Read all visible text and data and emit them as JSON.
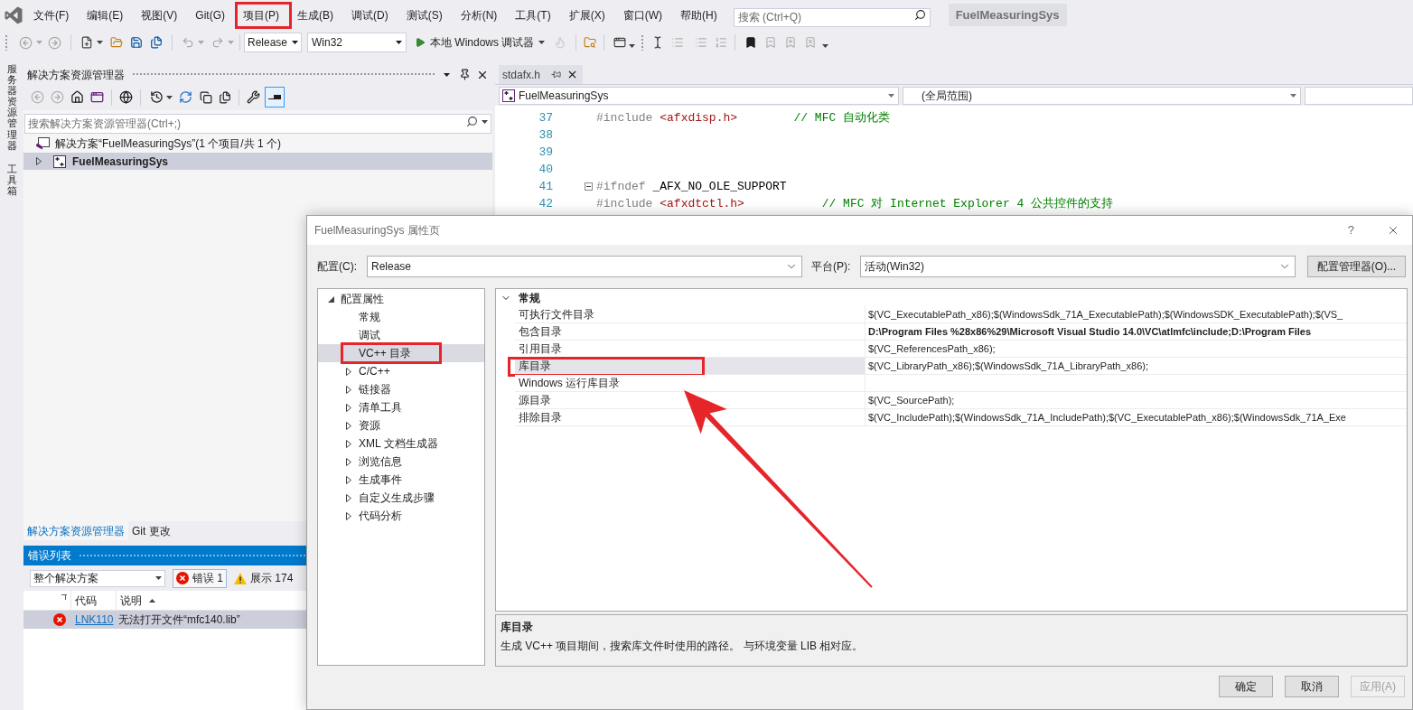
{
  "menu_bar": {
    "items": [
      {
        "label": "文件(F)",
        "marked": false
      },
      {
        "label": "编辑(E)",
        "marked": false
      },
      {
        "label": "视图(V)",
        "marked": false
      },
      {
        "label": "Git(G)",
        "marked": false
      },
      {
        "label": "项目(P)",
        "marked": true
      },
      {
        "label": "生成(B)",
        "marked": false
      },
      {
        "label": "调试(D)",
        "marked": false
      },
      {
        "label": "测试(S)",
        "marked": false
      },
      {
        "label": "分析(N)",
        "marked": false
      },
      {
        "label": "工具(T)",
        "marked": false
      },
      {
        "label": "扩展(X)",
        "marked": false
      },
      {
        "label": "窗口(W)",
        "marked": false
      },
      {
        "label": "帮助(H)",
        "marked": false
      }
    ],
    "search": {
      "placeholder": "搜索 (Ctrl+Q)"
    },
    "solution_badge": "FuelMeasuringSys"
  },
  "toolbar": {
    "configuration": "Release",
    "platform": "Win32",
    "debug_target": "本地 Windows 调试器"
  },
  "side_tabs": [
    {
      "label": "服务器资源管理器"
    },
    {
      "label": "工具箱"
    }
  ],
  "solution_explorer": {
    "title": "解决方案资源管理器",
    "search": {
      "placeholder": "搜索解决方案资源管理器(Ctrl+;)"
    },
    "tree": [
      {
        "kind": "solution",
        "label": "解决方案“FuelMeasuringSys”(1 个项目/共 1 个)",
        "selected": false,
        "children": [
          {
            "kind": "project",
            "label": "FuelMeasuringSys",
            "selected": true,
            "expanded": false
          }
        ]
      }
    ],
    "tabs": [
      {
        "label": "解决方案资源管理器",
        "selected": true
      },
      {
        "label": "Git 更改",
        "selected": false
      }
    ]
  },
  "error_list": {
    "title": "错误列表",
    "scope": "整个解决方案",
    "filters": [
      {
        "kind": "error",
        "label": "错误 1",
        "on": true
      },
      {
        "kind": "warning",
        "label": "展示 174",
        "on": false
      }
    ],
    "columns": [
      {
        "label": "代码",
        "sorted": false
      },
      {
        "label": "说明",
        "sorted": true
      }
    ],
    "rows": [
      {
        "kind": "error",
        "code": "LNK110",
        "description": "无法打开文件“mfc140.lib”",
        "selected": true
      }
    ]
  },
  "editor": {
    "tabs": [
      {
        "label": "stdafx.h",
        "selected": true
      }
    ],
    "navigation": {
      "project": "FuelMeasuringSys",
      "scope": "(全局范围)"
    },
    "lines": [
      {
        "number": "37",
        "foldable": false,
        "tokens": [
          {
            "kind": "directive",
            "text": "#include"
          },
          {
            "kind": "header",
            "text": "<afxdisp.h>"
          },
          {
            "kind": "comment",
            "text": "// MFC 自动化类"
          }
        ]
      },
      {
        "number": "38",
        "foldable": false
      },
      {
        "number": "39",
        "foldable": false
      },
      {
        "number": "40",
        "foldable": false
      },
      {
        "number": "41",
        "foldable": true,
        "tokens": [
          {
            "kind": "directive",
            "text": "#ifndef"
          },
          {
            "kind": "plain",
            "text": "_AFX_NO_OLE_SUPPORT"
          }
        ]
      },
      {
        "number": "42",
        "foldable": false,
        "tokens": [
          {
            "kind": "directive",
            "text": "#include"
          },
          {
            "kind": "header",
            "text": "<afxdtctl.h>"
          },
          {
            "kind": "comment",
            "text": "// MFC 对 Internet Explorer 4 公共控件的支持"
          }
        ]
      }
    ]
  },
  "dialog": {
    "title": "FuelMeasuringSys 属性页",
    "help_label": "?",
    "configuration": {
      "label": "配置(C):",
      "value": "Release"
    },
    "platform": {
      "label": "平台(P):",
      "value": "活动(Win32)"
    },
    "manager_button": "配置管理器(O)...",
    "tree": [
      {
        "label": "配置属性",
        "expanded": true,
        "selected": false,
        "marked": false,
        "children": [
          {
            "label": "常规",
            "selected": false,
            "marked": false
          },
          {
            "label": "调试",
            "selected": false,
            "marked": false
          },
          {
            "label": "VC++ 目录",
            "selected": true,
            "marked": true
          },
          {
            "label": "C/C++",
            "expanded": false,
            "selected": false,
            "marked": false
          },
          {
            "label": "链接器",
            "expanded": false,
            "selected": false,
            "marked": false
          },
          {
            "label": "清单工具",
            "expanded": false,
            "selected": false,
            "marked": false
          },
          {
            "label": "资源",
            "expanded": false,
            "selected": false,
            "marked": false
          },
          {
            "label": "XML 文档生成器",
            "expanded": false,
            "selected": false,
            "marked": false
          },
          {
            "label": "浏览信息",
            "expanded": false,
            "selected": false,
            "marked": false
          },
          {
            "label": "生成事件",
            "expanded": false,
            "selected": false,
            "marked": false
          },
          {
            "label": "自定义生成步骤",
            "expanded": false,
            "selected": false,
            "marked": false
          },
          {
            "label": "代码分析",
            "expanded": false,
            "selected": false,
            "marked": false
          }
        ]
      }
    ],
    "grid": {
      "category": {
        "label": "常规",
        "expanded": true
      },
      "rows": [
        {
          "name": "可执行文件目录",
          "value": "$(VC_ExecutablePath_x86);$(WindowsSdk_71A_ExecutablePath);$(WindowsSDK_ExecutablePath);$(VS_",
          "overridden": false,
          "selected": false,
          "marked": false
        },
        {
          "name": "包含目录",
          "value": "D:\\Program Files %28x86%29\\Microsoft Visual Studio 14.0\\VC\\atlmfc\\include;D:\\Program Files",
          "overridden": true,
          "selected": false,
          "marked": false
        },
        {
          "name": "引用目录",
          "value": "$(VC_ReferencesPath_x86);",
          "overridden": false,
          "selected": false,
          "marked": false
        },
        {
          "name": "库目录",
          "value": "$(VC_LibraryPath_x86);$(WindowsSdk_71A_LibraryPath_x86);",
          "overridden": false,
          "selected": true,
          "marked": true
        },
        {
          "name": "Windows 运行库目录",
          "selected": false,
          "marked": false
        },
        {
          "name": "源目录",
          "value": "$(VC_SourcePath);",
          "overridden": false,
          "selected": false,
          "marked": false
        },
        {
          "name": "排除目录",
          "value": "$(VC_IncludePath);$(WindowsSdk_71A_IncludePath);$(VC_ExecutablePath_x86);$(WindowsSdk_71A_Exe",
          "overridden": false,
          "selected": false,
          "marked": false
        }
      ]
    },
    "description": {
      "title": "库目录",
      "text": "生成 VC++ 项目期间，搜索库文件时使用的路径。 与环境变量 LIB 相对应。"
    },
    "buttons": [
      {
        "label": "确定",
        "disabled": false
      },
      {
        "label": "取消",
        "disabled": false
      },
      {
        "label": "应用(A)",
        "disabled": true
      }
    ]
  }
}
